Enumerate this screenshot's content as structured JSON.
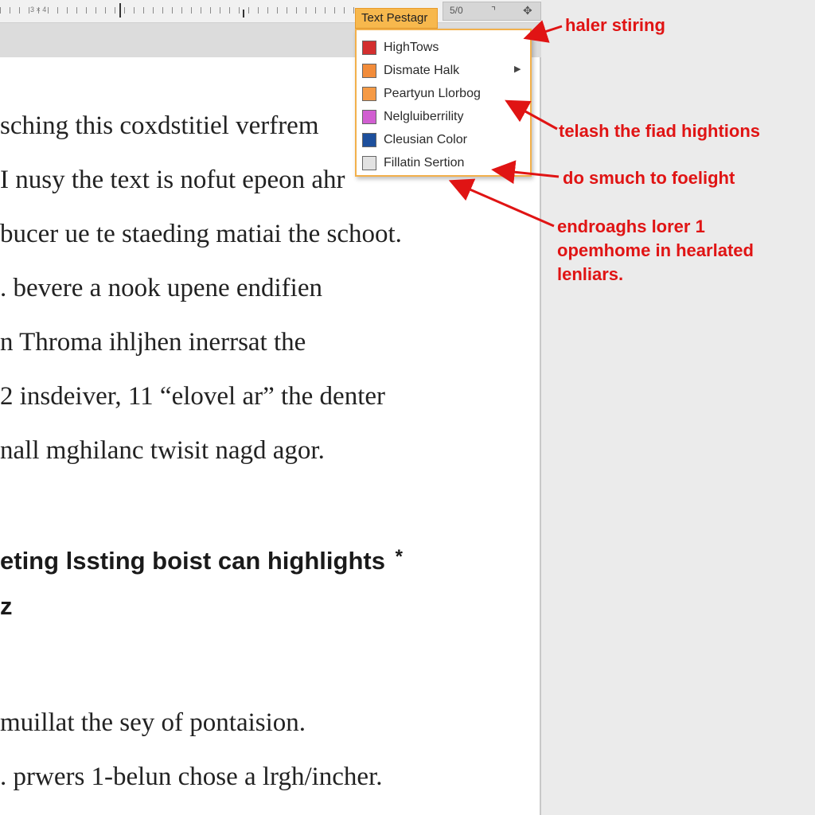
{
  "toolbar": {
    "ruler_small_label": "3 × 4",
    "zoom_label": "5/0",
    "icon_a": "crop-corner-icon",
    "icon_b": "pin-icon"
  },
  "dropdown": {
    "title": "Text Pestagr",
    "items": [
      {
        "label": "HighTows",
        "color": "#d32f2f"
      },
      {
        "label": "Dismate Halk",
        "color": "#f28c3a",
        "has_submenu": true
      },
      {
        "label": "Peartyun Llorbog",
        "color": "#f59a45"
      },
      {
        "label": "Nelgluiberrility",
        "color": "#d15ed1"
      },
      {
        "label": "Cleusian Color",
        "color": "#1d4f9c"
      },
      {
        "label": "Fillatin Sertion",
        "color": "#e2e2e2"
      }
    ]
  },
  "document": {
    "lines": [
      "sching this coxdstitiel verfrem",
      "I nusy the text is nofut epeon ahr",
      "bucer ue te staeding matiai the schoot.",
      ". bevere a nook upene endifien",
      "n Throma ihljhen inerrsat the",
      "2 insdeiver, 11 “elovel ar” the denter",
      "nall mghilanc twisit nagd agor."
    ],
    "heading": "eting lssting boist can highlights",
    "heading_mark": "*",
    "heading_2": "z",
    "lines_2": [
      " muillat the sey of pontaision.",
      ". prwers 1-belun chose a lrgh/incher."
    ]
  },
  "annotations": {
    "a1": "haler stiring",
    "a2": "telash the fiad hightions",
    "a3": "do smuch to foelight",
    "a4_l1": "endroaghs lorer 1",
    "a4_l2": "opemhome in hearlated",
    "a4_l3": "lenliars.",
    "color": "#e01414"
  }
}
